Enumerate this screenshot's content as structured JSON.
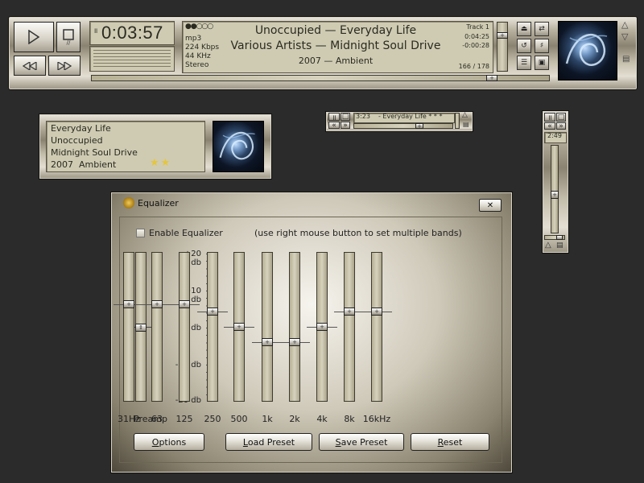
{
  "main": {
    "time": "0:03:57",
    "format": "mp3",
    "bitrate": "224 Kbps",
    "samplerate": "44 KHz",
    "channels": "Stereo",
    "title_line": "Unoccupied — Everyday Life",
    "artist_line": "Various Artists — Midnight Soul Drive",
    "year_genre": "2007 — Ambient",
    "track_label": "Track 1",
    "remaining": "0:04:25",
    "elapsed_neg": "-0:00:28",
    "playlist_pos": "166 / 178",
    "stop_hint": "//"
  },
  "info": {
    "title": "Everyday Life",
    "album": "Unoccupied",
    "artist": "Midnight Soul Drive",
    "year_genre": "2007  Ambient",
    "stars": "★★"
  },
  "mini": {
    "time": "3:23",
    "text": "- Everyday Life * * *"
  },
  "vertical": {
    "time": "2:49"
  },
  "equalizer": {
    "title": "Equalizer",
    "close_label": "✕",
    "enable_label": "Enable Equalizer",
    "hint": "(use right mouse button to set multiple bands)",
    "db_labels": [
      "+20 db",
      "+10 db",
      "0 db",
      "-10 db",
      "-20 db"
    ],
    "preamp_label": "Preamp",
    "preamp_value": 0,
    "bands": [
      {
        "label": "31Hz",
        "value": 6
      },
      {
        "label": "63",
        "value": 6
      },
      {
        "label": "125",
        "value": 6
      },
      {
        "label": "250",
        "value": 4
      },
      {
        "label": "500",
        "value": 0
      },
      {
        "label": "1k",
        "value": -4
      },
      {
        "label": "2k",
        "value": -4
      },
      {
        "label": "4k",
        "value": 0
      },
      {
        "label": "8k",
        "value": 4
      },
      {
        "label": "16kHz",
        "value": 4
      }
    ],
    "buttons": {
      "options": "Options",
      "load": "Load Preset",
      "save": "Save Preset",
      "reset": "Reset"
    }
  }
}
